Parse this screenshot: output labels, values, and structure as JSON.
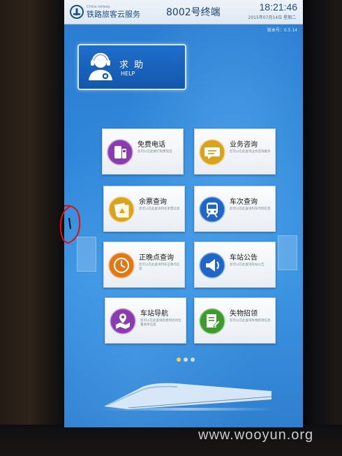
{
  "header": {
    "logo_small": "China railway",
    "logo_main": "铁路旅客云服务",
    "terminal_title": "8002号终端",
    "time": "18:21:46",
    "date": "2015年07月14日 星期二",
    "version": "版本号：0.5.14"
  },
  "help": {
    "label_cn": "求  助",
    "label_en": "HELP",
    "icon": "headset-agent-icon"
  },
  "tiles": [
    {
      "title": "免费电话",
      "desc": "您可以在此拨打免费电话",
      "icon": "phone-icon",
      "color": "#8a3bb0"
    },
    {
      "title": "业务咨询",
      "desc": "您可以在此查询业务咨询服务",
      "icon": "chat-icon",
      "color": "#d9a21f"
    },
    {
      "title": "余票查询",
      "desc": "您可以在此查询列车余票信息",
      "icon": "ticket-icon",
      "color": "#d9a21f"
    },
    {
      "title": "车次查询",
      "desc": "您可以在此查询列车时刻信息",
      "icon": "train-icon",
      "color": "#1f66c7"
    },
    {
      "title": "正晚点查询",
      "desc": "您可以在此查询列车正晚点信息",
      "icon": "clock-icon",
      "color": "#e07818"
    },
    {
      "title": "车站公告",
      "desc": "您可以在此查询车站公告",
      "icon": "megaphone-icon",
      "color": "#1f66c7"
    },
    {
      "title": "车站导航",
      "desc": "您可以在此查询您想到达的位置具体信息",
      "icon": "map-pin-icon",
      "color": "#8a3bb0"
    },
    {
      "title": "失物招领",
      "desc": "您可以在此查询失物招领信息",
      "icon": "document-icon",
      "color": "#3e9a2e"
    }
  ],
  "pagination": {
    "pages": 3,
    "active": 1
  },
  "watermark": "www.wooyun.org",
  "colors": {
    "screen_blue": "#2f86d8",
    "header_bg": "#eef3f9",
    "help_bg": "#1357ad",
    "dot_active": "#f2d54a"
  }
}
